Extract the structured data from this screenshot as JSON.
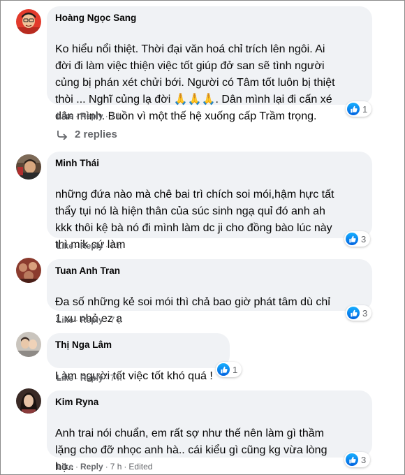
{
  "comments": [
    {
      "author": "Hoàng Ngọc Sang",
      "lines": [
        "Ko hiểu nổi thiệt. Thời đại văn hoá chỉ trích lên ngôi. Ai",
        "đời đi làm việc thiện việc tốt giúp đở san sẽ tình người",
        "củng bị phán xét chửi bới. Người có Tâm tốt luôn bị thiệt",
        "thòi ... Nghĩ củng lạ đời 🙏🙏🙏. Dân mình lại đi cấn xé",
        "dân mình. Buồn vì một thế hệ xuống cấp Trầm trọng."
      ],
      "like_label": "Like",
      "reply_label": "Reply",
      "time": "7 h",
      "edited": "",
      "reaction_count": "1",
      "replies_label": "2 replies",
      "avatar_colors": {
        "bg": "#e23a2c",
        "face": "#f1c39a",
        "hair": "#1c1c1c"
      }
    },
    {
      "author": "Minh Thái",
      "lines": [
        "những đứa nào mà chê bai trì chích soi mói,hậm hực tất",
        "thẩy tụi nó là hiện thân của súc sinh ngạ quỉ đó anh ah",
        "kkk thôi kệ bà nó đi mình làm dc ji cho đồng bào lúc này",
        "thì mik cứ làm"
      ],
      "like_label": "Like",
      "reply_label": "Reply",
      "time": "7 h",
      "edited": "",
      "reaction_count": "3",
      "avatar_colors": {
        "bg": "#5a4636",
        "face": "#d8a77f",
        "hair": "#2a1f18"
      }
    },
    {
      "author": "Tuan Anh Tran",
      "lines": [
        "Đa số những kẻ soi mói thì chả bao giờ phát tâm dù chỉ",
        "1 xu nhỏ ez ạ"
      ],
      "like_label": "Like",
      "reply_label": "Reply",
      "time": "7 h",
      "edited": "",
      "reaction_count": "3",
      "avatar_colors": {
        "bg": "#8b3b2e",
        "face": "#c98b6c",
        "hair": "#3a2118"
      }
    },
    {
      "author": "Thị Nga Lâm",
      "lines": [
        "Làm người tốt việc tốt khó quá !"
      ],
      "like_label": "Like",
      "reply_label": "Reply",
      "time": "7 h",
      "edited": "",
      "reaction_count": "1",
      "avatar_colors": {
        "bg": "#c9c4bd",
        "face": "#e9c8aa",
        "hair": "#3b2c24"
      }
    },
    {
      "author": "Kim Ryna",
      "lines": [
        "Anh trai nói chuẩn, em rất sợ như thế nên làm gì thầm",
        "lặng cho đỡ nhọc anh hà.. cái kiểu gì cũng kg vừa lòng",
        "họ.."
      ],
      "like_label": "Like",
      "reply_label": "Reply",
      "time": "7 h",
      "edited": "Edited",
      "reaction_count": "3",
      "avatar_colors": {
        "bg": "#3a2a26",
        "face": "#e6c2a6",
        "hair": "#1a1210"
      }
    }
  ]
}
